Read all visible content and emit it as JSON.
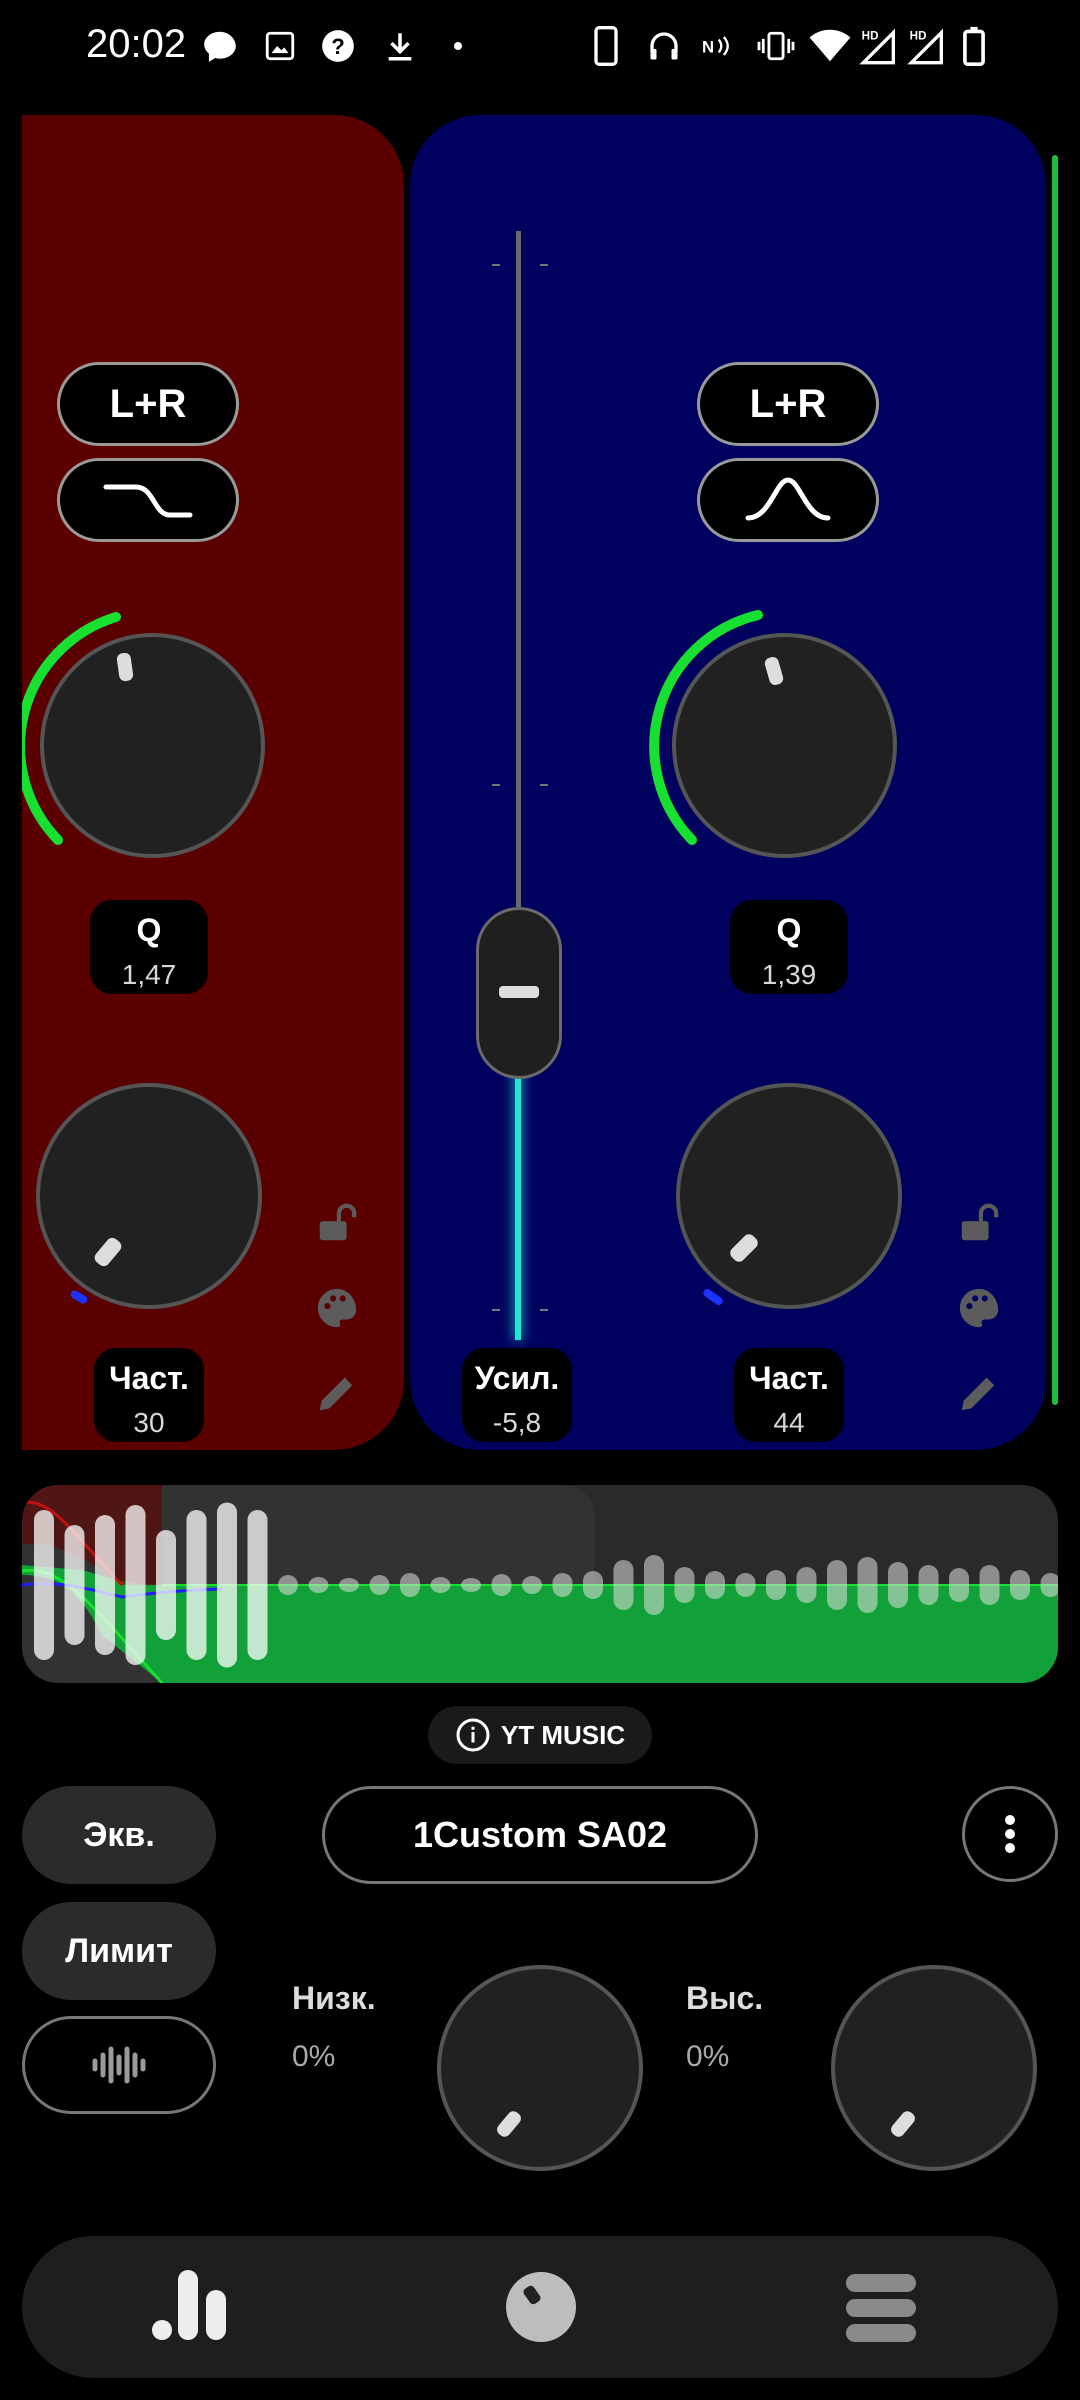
{
  "status_bar": {
    "time": "20:02",
    "icons_left": [
      "chat-icon",
      "image-icon",
      "help-icon",
      "download-icon",
      "dot-icon"
    ],
    "icons_right": [
      "phone-icon",
      "headphones-icon",
      "nfc-icon",
      "vibrate-icon",
      "wifi-icon",
      "signal-hd-1-icon",
      "signal-hd-2-icon",
      "battery-icon"
    ],
    "hd_label": "HD"
  },
  "bands": {
    "left": {
      "color": "#5a0000",
      "channel": "L+R",
      "filter_icon": "low-shelf-icon",
      "q_label": "Q",
      "q_value": "1,47",
      "freq_label": "Част.",
      "freq_value": "30"
    },
    "center": {
      "color": "#00005e",
      "channel": "L+R",
      "filter_icon": "peak-icon",
      "gain_label": "Усил.",
      "gain_value": "-5,8",
      "gain_fraction": 0.41,
      "q_label": "Q",
      "q_value": "1,39",
      "freq_label": "Част.",
      "freq_value": "44"
    }
  },
  "side_icons": [
    "lock-open-icon",
    "palette-icon",
    "pencil-icon"
  ],
  "source_chip": {
    "label": "YT MUSIC",
    "icon": "info-icon"
  },
  "controls": {
    "eq_button": "Экв.",
    "limit_button": "Лимит",
    "preset_name": "1Custom SA02",
    "more_icon": "more-vert-icon",
    "wave_icon": "waveform-icon",
    "low_label": "Низк.",
    "low_value": "0%",
    "high_label": "Выс.",
    "high_value": "0%"
  },
  "nav": {
    "items": [
      "equalizer-bars-icon",
      "knob-icon",
      "menu-stack-icon"
    ]
  },
  "colors": {
    "accent_green": "#18e030",
    "accent_cyan": "#1de9d9",
    "band_green": "#12a038"
  }
}
